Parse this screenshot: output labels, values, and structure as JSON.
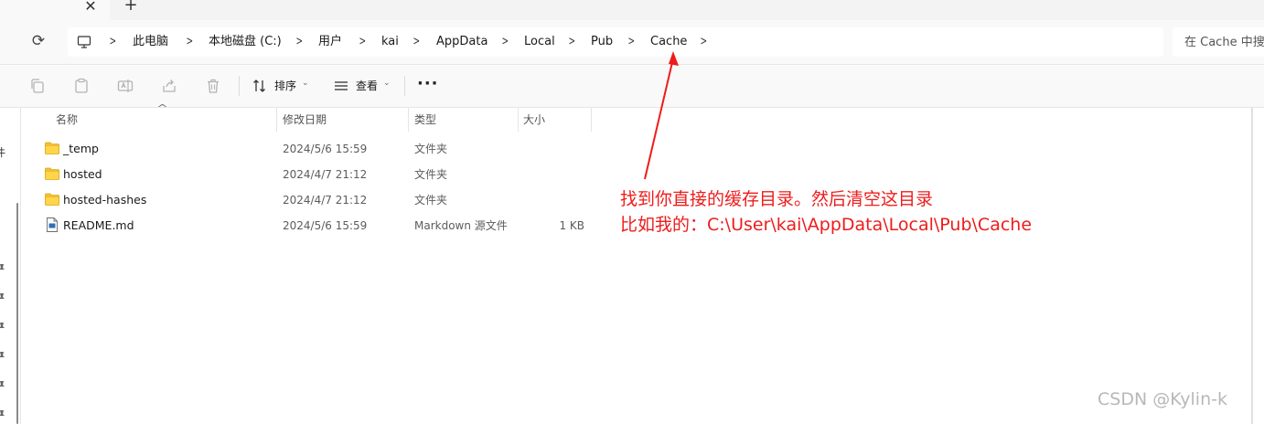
{
  "tabs": {
    "close_glyph": "✕",
    "new_tab_glyph": "+"
  },
  "nav": {
    "refresh_glyph": "⟳",
    "breadcrumb": [
      {
        "label": "此电脑"
      },
      {
        "label": "本地磁盘 (C:)"
      },
      {
        "label": "用户"
      },
      {
        "label": "kai"
      },
      {
        "label": "AppData"
      },
      {
        "label": "Local"
      },
      {
        "label": "Pub"
      },
      {
        "label": "Cache"
      }
    ],
    "search_placeholder": "在 Cache 中搜"
  },
  "toolbar": {
    "sort_label": "排序",
    "view_label": "查看",
    "more_glyph": "···",
    "dropdown_glyph": "⌄"
  },
  "columns": {
    "name": "名称",
    "modified": "修改日期",
    "type": "类型",
    "size": "大小"
  },
  "files": [
    {
      "name": "_temp",
      "modified": "2024/5/6 15:59",
      "type": "文件夹",
      "size": "",
      "icon": "folder-icon"
    },
    {
      "name": "hosted",
      "modified": "2024/4/7 21:12",
      "type": "文件夹",
      "size": "",
      "icon": "folder-icon"
    },
    {
      "name": "hosted-hashes",
      "modified": "2024/4/7 21:12",
      "type": "文件夹",
      "size": "",
      "icon": "folder-icon"
    },
    {
      "name": "README.md",
      "modified": "2024/5/6 15:59",
      "type": "Markdown 源文件",
      "size": "1 KB",
      "icon": "markdown-file-icon"
    }
  ],
  "annotation": {
    "line1": "找到你直接的缓存目录。然后清空这目录",
    "line2": "比如我的：C:\\User\\kai\\AppData\\Local\\Pub\\Cache",
    "color": "#ee1c1c"
  },
  "left_pane": {
    "clipped_char": "件"
  },
  "watermark": "CSDN @Kylin-k",
  "colors": {
    "folder": "#f4c430",
    "accent_red": "#ee1c1c"
  }
}
